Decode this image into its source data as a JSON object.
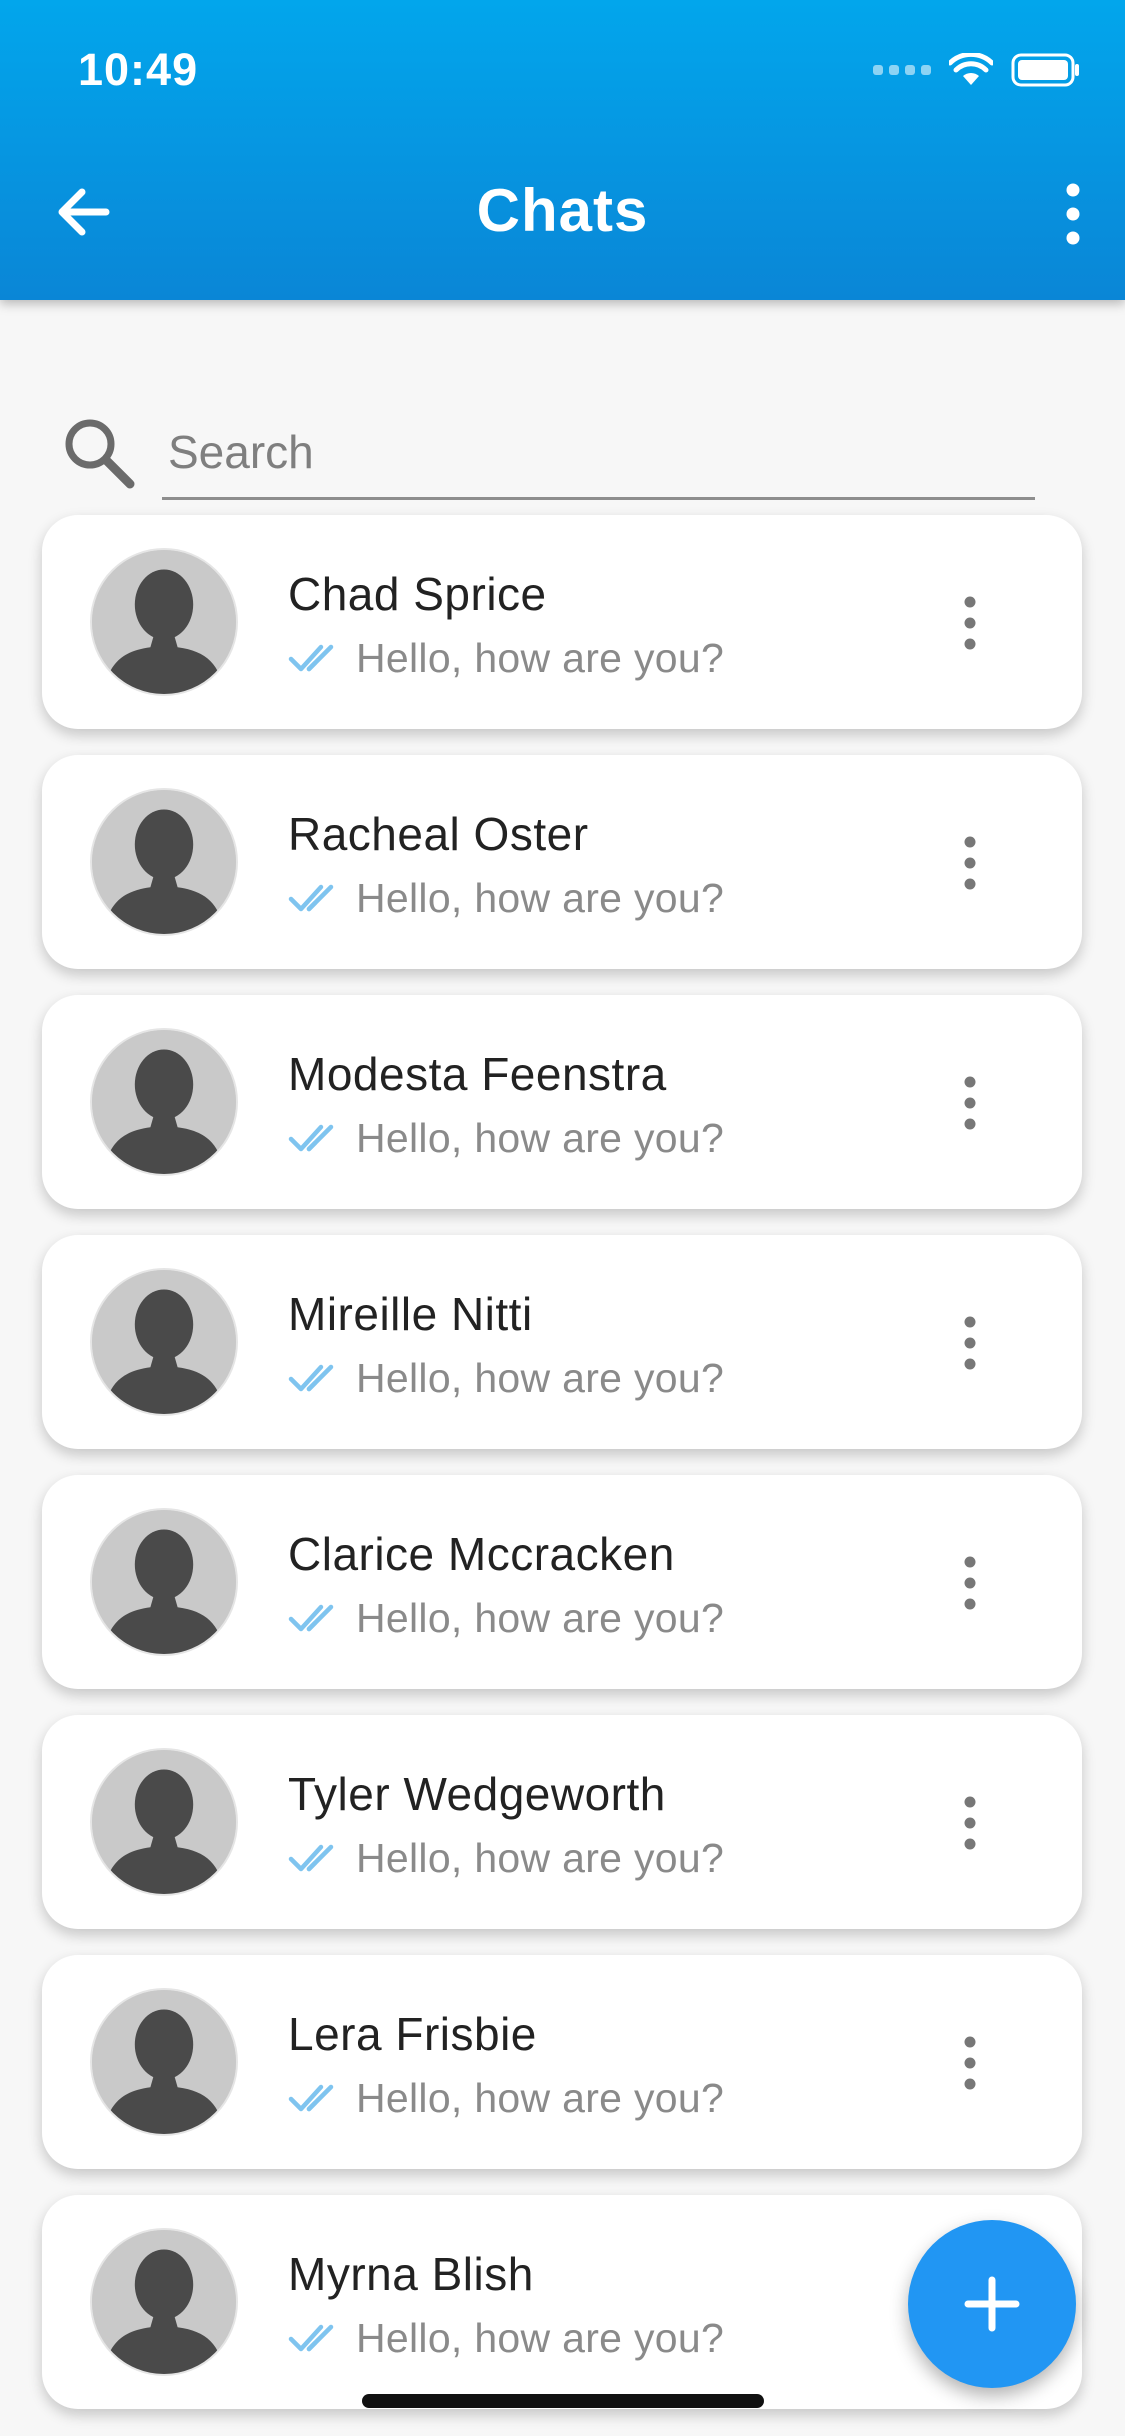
{
  "status_bar": {
    "time": "10:49"
  },
  "app_bar": {
    "title": "Chats",
    "back_icon": "arrow-back-icon",
    "menu_icon": "more-vert-icon"
  },
  "search": {
    "placeholder": "Search",
    "value": ""
  },
  "chats": [
    {
      "name": "Chad Sprice",
      "message": "Hello, how are you?"
    },
    {
      "name": "Racheal Oster",
      "message": "Hello, how are you?"
    },
    {
      "name": "Modesta Feenstra",
      "message": "Hello, how are you?"
    },
    {
      "name": "Mireille Nitti",
      "message": "Hello, how are you?"
    },
    {
      "name": "Clarice Mccracken",
      "message": "Hello, how are you?"
    },
    {
      "name": "Tyler Wedgeworth",
      "message": "Hello, how are you?"
    },
    {
      "name": "Lera Frisbie",
      "message": "Hello, how are you?"
    },
    {
      "name": "Myrna Blish",
      "message": "Hello, how are you?"
    }
  ],
  "fab": {
    "icon": "plus-icon"
  },
  "colors": {
    "app_bar": "#0a8fdd",
    "fab": "#2196f3",
    "tick": "#7fc4ef"
  }
}
